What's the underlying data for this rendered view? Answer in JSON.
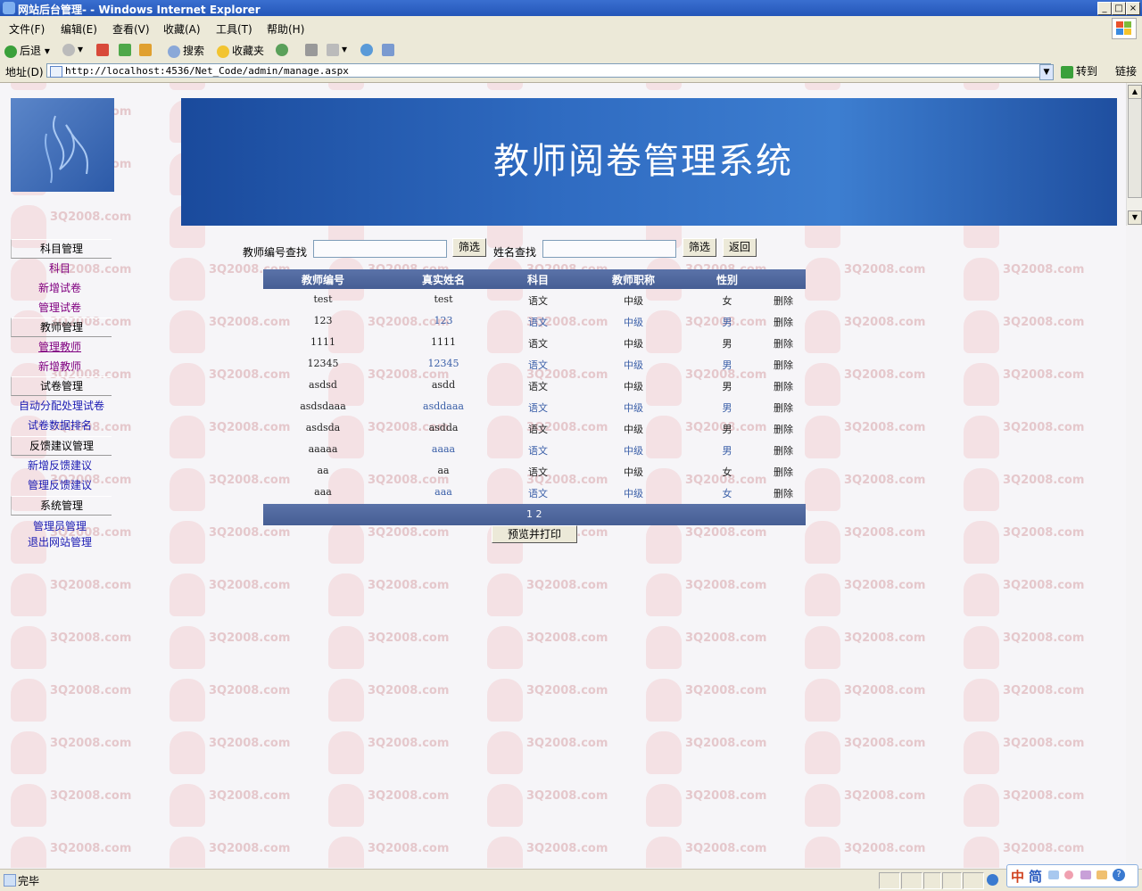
{
  "window": {
    "title": "网站后台管理- - Windows Internet Explorer",
    "controls": [
      "_",
      "□",
      "×"
    ]
  },
  "menu": [
    "文件(F)",
    "编辑(E)",
    "查看(V)",
    "收藏(A)",
    "工具(T)",
    "帮助(H)"
  ],
  "toolbar": {
    "back": "后退",
    "search": "搜索",
    "favorites": "收藏夹"
  },
  "address": {
    "label": "地址(D)",
    "url": "http://localhost:4536/Net_Code/admin/manage.aspx",
    "go": "转到",
    "links": "链接"
  },
  "watermark_text": "3Q2008.com",
  "banner": {
    "title": "教师阅卷管理系统"
  },
  "sidebar": {
    "sections": [
      {
        "title": "科目管理",
        "links": [
          "科目",
          "新增试卷",
          "管理试卷"
        ]
      },
      {
        "title": "教师管理",
        "links": [
          "管理教师",
          "新增教师"
        ]
      },
      {
        "title": "试卷管理",
        "links": [
          "自动分配处理试卷",
          "试卷数据排名"
        ]
      },
      {
        "title": "反馈建议管理",
        "links": [
          "新增反馈建议",
          "管理反馈建议"
        ]
      },
      {
        "title": "系统管理",
        "links": [
          "管理员管理",
          "退出网站管理"
        ]
      }
    ]
  },
  "search": {
    "id_label": "教师编号查找",
    "id_value": "",
    "filter1": "筛选",
    "name_label": "姓名查找",
    "name_value": "",
    "filter2": "筛选",
    "back": "返回"
  },
  "grid": {
    "headers": [
      "教师编号",
      "真实姓名",
      "科目",
      "教师职称",
      "性别"
    ],
    "rows": [
      [
        "test",
        "test",
        "语文",
        "中级",
        "女",
        "删除"
      ],
      [
        "123",
        "123",
        "语文",
        "中级",
        "男",
        "删除"
      ],
      [
        "1111",
        "1111",
        "语文",
        "中级",
        "男",
        "删除"
      ],
      [
        "12345",
        "12345",
        "语文",
        "中级",
        "男",
        "删除"
      ],
      [
        "asdsd",
        "asdd",
        "语文",
        "中级",
        "男",
        "删除"
      ],
      [
        "asdsdaaa",
        "asddaaa",
        "语文",
        "中级",
        "男",
        "删除"
      ],
      [
        "asdsda",
        "asdda",
        "语文",
        "中级",
        "男",
        "删除"
      ],
      [
        "aaaaa",
        "aaaa",
        "语文",
        "中级",
        "男",
        "删除"
      ],
      [
        "aa",
        "aa",
        "语文",
        "中级",
        "女",
        "删除"
      ],
      [
        "aaa",
        "aaa",
        "语文",
        "中级",
        "女",
        "删除"
      ]
    ],
    "pager": "1 2",
    "print_button": "预览并打印"
  },
  "status": {
    "text": "完毕"
  },
  "ime": {
    "chars": [
      "中",
      "简"
    ]
  }
}
